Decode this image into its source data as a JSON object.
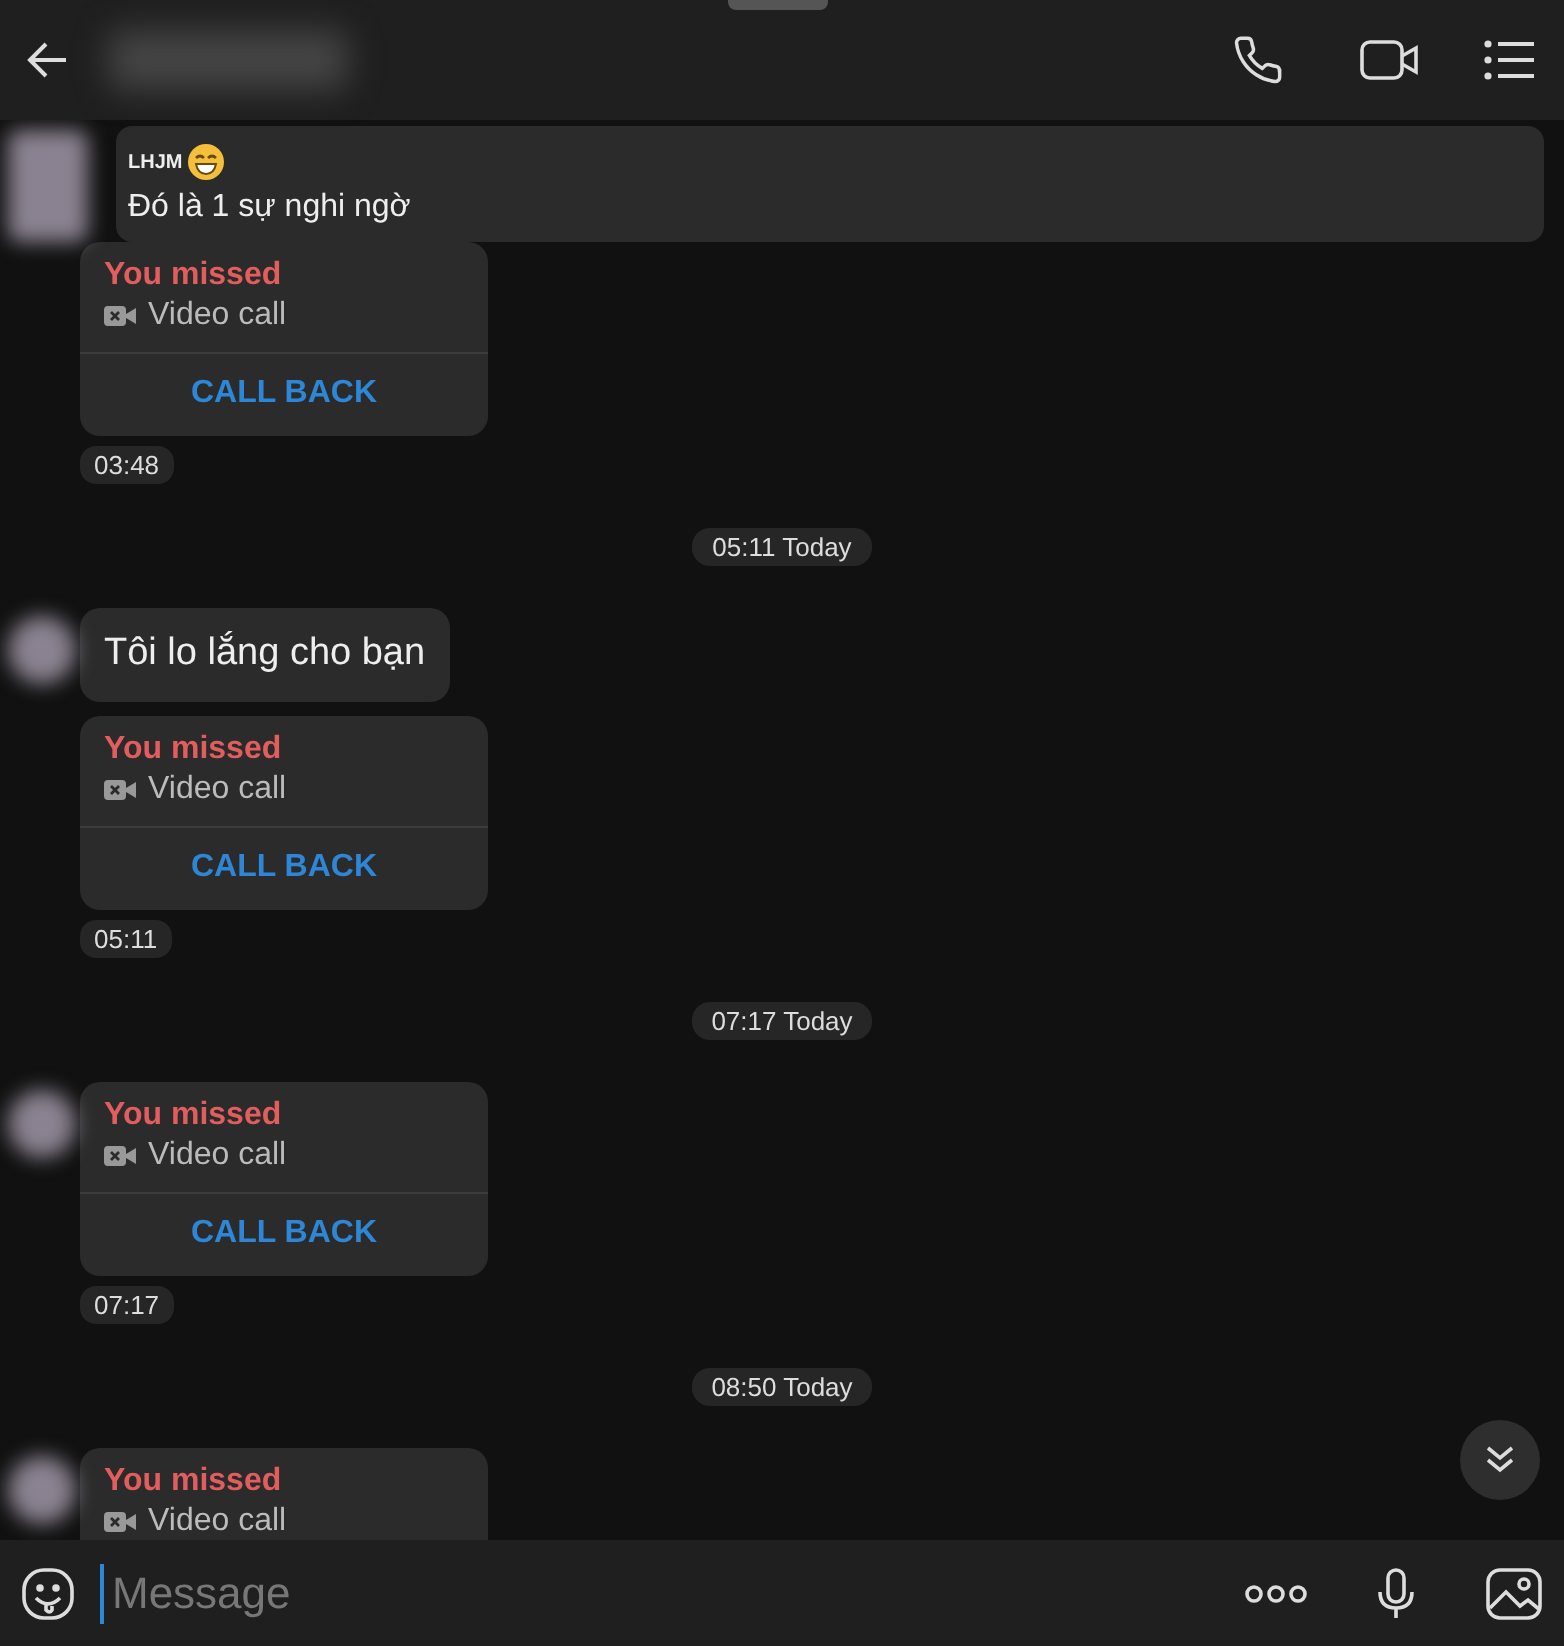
{
  "messages": [
    {
      "kind": "quote",
      "avatar": true,
      "sender": "LHJM",
      "text": "Đó là 1 sự nghi ngờ"
    },
    {
      "kind": "missed_call",
      "avatar": false,
      "title": "You missed",
      "call_type": "Video call",
      "action": "CALL BACK"
    },
    {
      "kind": "time",
      "text": "03:48"
    },
    {
      "kind": "divider",
      "text": "05:11 Today"
    },
    {
      "kind": "text",
      "avatar": true,
      "text": "Tôi lo lắng cho bạn"
    },
    {
      "kind": "missed_call",
      "avatar": false,
      "title": "You missed",
      "call_type": "Video call",
      "action": "CALL BACK"
    },
    {
      "kind": "time",
      "text": "05:11"
    },
    {
      "kind": "divider",
      "text": "07:17 Today"
    },
    {
      "kind": "missed_call",
      "avatar": true,
      "title": "You missed",
      "call_type": "Video call",
      "action": "CALL BACK"
    },
    {
      "kind": "time",
      "text": "07:17"
    },
    {
      "kind": "divider",
      "text": "08:50 Today"
    },
    {
      "kind": "missed_call",
      "avatar": true,
      "title": "You missed",
      "call_type": "Video call"
    }
  ],
  "composer": {
    "placeholder": "Message"
  }
}
